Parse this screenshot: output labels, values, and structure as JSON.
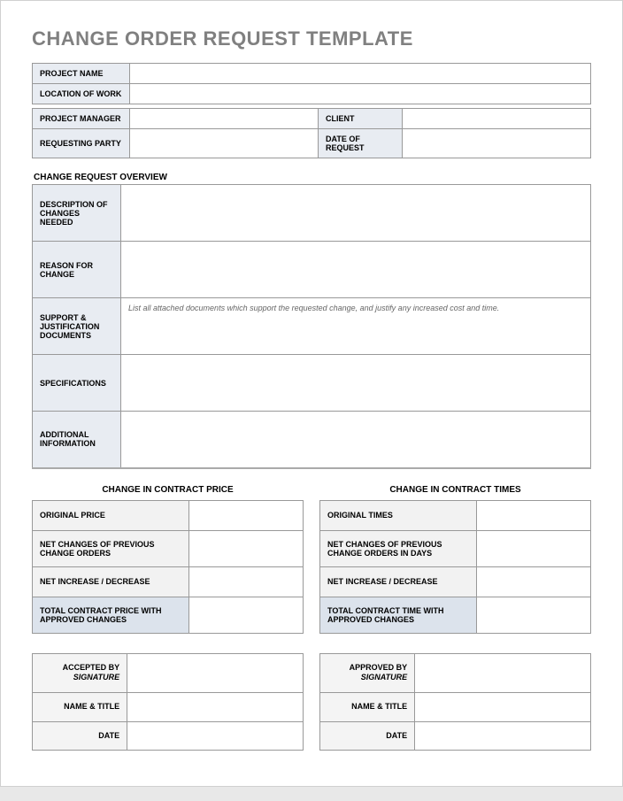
{
  "title": "CHANGE ORDER REQUEST TEMPLATE",
  "header": {
    "project_name_label": "PROJECT NAME",
    "project_name_value": "",
    "location_label": "LOCATION OF WORK",
    "location_value": "",
    "pm_label": "PROJECT MANAGER",
    "pm_value": "",
    "client_label": "CLIENT",
    "client_value": "",
    "requesting_label": "REQUESTING PARTY",
    "requesting_value": "",
    "date_label": "DATE OF REQUEST",
    "date_value": ""
  },
  "overview": {
    "section_title": "CHANGE REQUEST OVERVIEW",
    "desc_label": "DESCRIPTION OF CHANGES NEEDED",
    "desc_value": "",
    "reason_label": "REASON FOR CHANGE",
    "reason_value": "",
    "support_label": "SUPPORT & JUSTIFICATION DOCUMENTS",
    "support_value": "List all attached documents which support the requested change, and justify any increased cost and time.",
    "spec_label": "SPECIFICATIONS",
    "spec_value": "",
    "additional_label": "ADDITIONAL INFORMATION",
    "additional_value": ""
  },
  "price": {
    "title": "CHANGE IN CONTRACT PRICE",
    "original_label": "ORIGINAL PRICE",
    "original_value": "",
    "net_prev_label": "NET CHANGES OF PREVIOUS CHANGE ORDERS",
    "net_prev_value": "",
    "net_inc_label": "NET INCREASE / DECREASE",
    "net_inc_value": "",
    "total_label": "TOTAL CONTRACT PRICE WITH APPROVED CHANGES",
    "total_value": ""
  },
  "times": {
    "title": "CHANGE IN CONTRACT TIMES",
    "original_label": "ORIGINAL TIMES",
    "original_value": "",
    "net_prev_label": "NET CHANGES OF PREVIOUS CHANGE ORDERS IN DAYS",
    "net_prev_value": "",
    "net_inc_label": "NET INCREASE / DECREASE",
    "net_inc_value": "",
    "total_label": "TOTAL CONTRACT TIME WITH APPROVED CHANGES",
    "total_value": ""
  },
  "accepted": {
    "sig_label_1": "ACCEPTED BY",
    "sig_label_2": "SIGNATURE",
    "sig_value": "",
    "name_label": "NAME & TITLE",
    "name_value": "",
    "date_label": "DATE",
    "date_value": ""
  },
  "approved": {
    "sig_label_1": "APPROVED BY",
    "sig_label_2": "SIGNATURE",
    "sig_value": "",
    "name_label": "NAME & TITLE",
    "name_value": "",
    "date_label": "DATE",
    "date_value": ""
  }
}
